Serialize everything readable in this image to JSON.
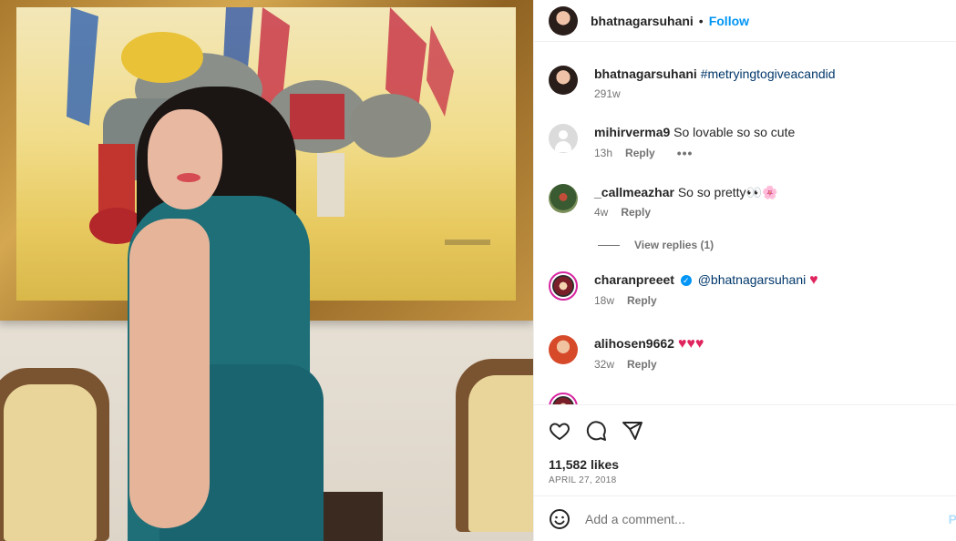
{
  "header": {
    "username": "bhatnagarsuhani",
    "separator": "•",
    "follow_label": "Follow"
  },
  "caption": {
    "username": "bhatnagarsuhani",
    "text": "#metryingtogiveacandid",
    "time": "291w"
  },
  "comments": [
    {
      "username": "mihirverma9",
      "text": "So lovable so so cute",
      "time": "13h",
      "reply": "Reply",
      "more": "•••"
    },
    {
      "username": "_callmeazhar",
      "text": "So so pretty👀🌸",
      "time": "4w",
      "reply": "Reply"
    },
    {
      "username": "charanpreeet",
      "mention": "@bhatnagarsuhani",
      "time": "18w",
      "reply": "Reply"
    },
    {
      "username": "alihosen9662",
      "time": "32w",
      "reply": "Reply"
    }
  ],
  "view_replies": "View replies (1)",
  "likes": "11,582 likes",
  "date": "APRIL 27, 2018",
  "add_comment": {
    "placeholder": "Add a comment...",
    "post_label": "P"
  },
  "icons": {
    "like": "heart-icon",
    "comment": "comment-icon",
    "share": "share-icon",
    "emoji": "emoji-icon",
    "verified": "verified-icon"
  },
  "colors": {
    "accent": "#0095f6",
    "heart": "#e0245e"
  }
}
